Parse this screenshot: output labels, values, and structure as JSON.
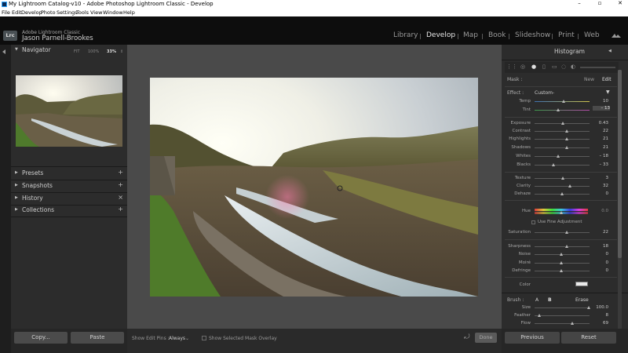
{
  "window": {
    "title": "My Lightroom Catalog-v10 - Adobe Photoshop Lightroom Classic - Develop",
    "controls": {
      "minimize": "–",
      "maximize": "▫",
      "close": "✕"
    }
  },
  "menu": [
    "File",
    "Edit",
    "Develop",
    "Photo",
    "Settings",
    "Tools",
    "View",
    "Window",
    "Help"
  ],
  "identity": {
    "badge": "Lrc",
    "app": "Adobe Lightroom Classic",
    "user": "Jason Parnell-Brookes"
  },
  "modules": [
    {
      "label": "Library",
      "active": false
    },
    {
      "label": "Develop",
      "active": true
    },
    {
      "label": "Map",
      "active": false
    },
    {
      "label": "Book",
      "active": false
    },
    {
      "label": "Slideshow",
      "active": false
    },
    {
      "label": "Print",
      "active": false
    },
    {
      "label": "Web",
      "active": false
    }
  ],
  "left": {
    "navigator": {
      "title": "Navigator",
      "zoom": [
        "FIT",
        "100%",
        "33%"
      ],
      "zoom_selected": "33%"
    },
    "panels": [
      "Presets",
      "Snapshots",
      "History",
      "Collections"
    ],
    "panel_actions": [
      "+",
      "+",
      "×",
      "+"
    ],
    "copy": "Copy...",
    "paste": "Paste"
  },
  "toolbar": {
    "show_edit_pins_label": "Show Edit Pins :",
    "show_edit_pins_value": "Always",
    "mask_overlay": "Show Selected Mask Overlay",
    "done": "Done"
  },
  "right": {
    "histogram": "Histogram",
    "mask_label": "Mask :",
    "mask_new": "New",
    "mask_edit": "Edit",
    "effect_label": "Effect :",
    "effect_value": "Custom",
    "sliders_top": [
      {
        "label": "Temp",
        "value": "10"
      },
      {
        "label": "Tint",
        "value": "– 13"
      }
    ],
    "sliders_tone": [
      {
        "label": "Exposure",
        "value": "0.43"
      },
      {
        "label": "Contrast",
        "value": "22"
      },
      {
        "label": "Highlights",
        "value": "21"
      },
      {
        "label": "Shadows",
        "value": "21"
      },
      {
        "label": "Whites",
        "value": "– 18"
      },
      {
        "label": "Blacks",
        "value": "– 33"
      }
    ],
    "sliders_presence": [
      {
        "label": "Texture",
        "value": "3"
      },
      {
        "label": "Clarity",
        "value": "32"
      },
      {
        "label": "Dehaze",
        "value": "0"
      }
    ],
    "hue": {
      "label": "Hue",
      "value": "0.0"
    },
    "fine_adjust": "Use Fine Adjustment",
    "saturation": {
      "label": "Saturation",
      "value": "22"
    },
    "sliders_detail": [
      {
        "label": "Sharpness",
        "value": "18"
      },
      {
        "label": "Noise",
        "value": "0"
      },
      {
        "label": "Moiré",
        "value": "0"
      },
      {
        "label": "Defringe",
        "value": "0"
      }
    ],
    "color_label": "Color",
    "brush": {
      "label": "Brush :",
      "a": "A",
      "b": "B",
      "erase": "Erase",
      "size": {
        "label": "Size",
        "value": "100.0"
      },
      "feather": {
        "label": "Feather",
        "value": "8"
      },
      "flow": {
        "label": "Flow",
        "value": "69"
      }
    },
    "previous": "Previous",
    "reset": "Reset"
  }
}
